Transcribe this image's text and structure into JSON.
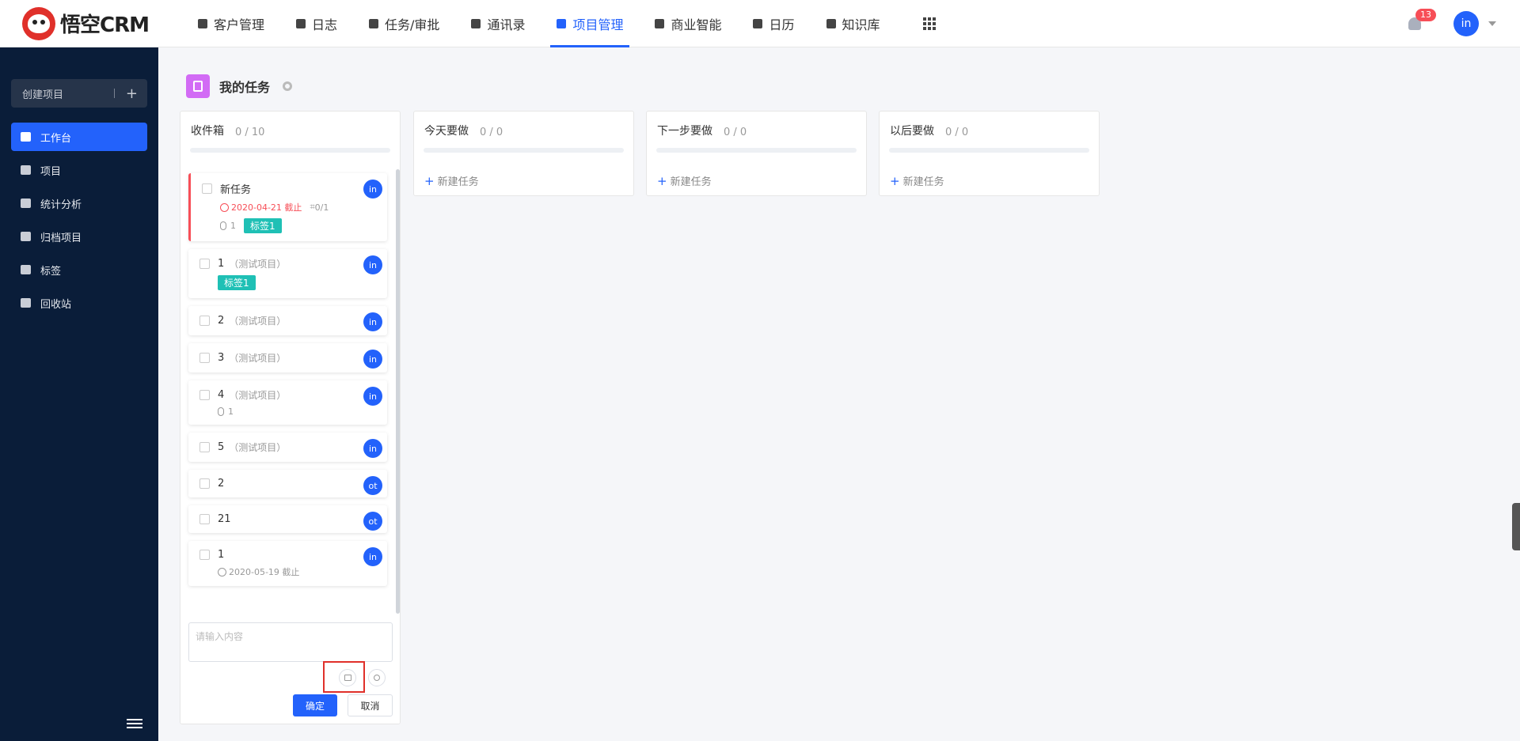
{
  "app": {
    "logo_text": "悟空CRM"
  },
  "nav": [
    {
      "label": "客户管理",
      "icon": "building-icon"
    },
    {
      "label": "日志",
      "icon": "journal-icon"
    },
    {
      "label": "任务/审批",
      "icon": "briefcase-icon"
    },
    {
      "label": "通讯录",
      "icon": "phone-book-icon"
    },
    {
      "label": "项目管理",
      "icon": "project-icon",
      "active": true
    },
    {
      "label": "商业智能",
      "icon": "bi-icon"
    },
    {
      "label": "日历",
      "icon": "calendar-icon"
    },
    {
      "label": "知识库",
      "icon": "book-icon"
    }
  ],
  "header": {
    "notification_count": "13",
    "user_initials": "in"
  },
  "sidebar": {
    "create_label": "创建项目",
    "create_plus": "+",
    "items": [
      {
        "label": "工作台",
        "active": true
      },
      {
        "label": "项目"
      },
      {
        "label": "统计分析"
      },
      {
        "label": "归档项目"
      },
      {
        "label": "标签"
      },
      {
        "label": "回收站"
      }
    ]
  },
  "page": {
    "title": "我的任务"
  },
  "columns": [
    {
      "title": "收件箱",
      "count": "0 / 10"
    },
    {
      "title": "今天要做",
      "count": "0 / 0",
      "new_task": "新建任务"
    },
    {
      "title": "下一步要做",
      "count": "0 / 0",
      "new_task": "新建任务"
    },
    {
      "title": "以后要做",
      "count": "0 / 0",
      "new_task": "新建任务"
    }
  ],
  "tasks": [
    {
      "name": "新任务",
      "project": "",
      "assignee": "in",
      "due": "2020-04-21 截止",
      "subtasks": "0/1",
      "attachments": "1",
      "tag": "标签1"
    },
    {
      "name": "1",
      "project": "（测试项目）",
      "assignee": "in",
      "tag": "标签1"
    },
    {
      "name": "2",
      "project": "（测试项目）",
      "assignee": "in"
    },
    {
      "name": "3",
      "project": "（测试项目）",
      "assignee": "in"
    },
    {
      "name": "4",
      "project": "（测试项目）",
      "assignee": "in",
      "attachments": "1"
    },
    {
      "name": "5",
      "project": "（测试项目）",
      "assignee": "in"
    },
    {
      "name": "2",
      "project": "",
      "assignee": "ot"
    },
    {
      "name": "21",
      "project": "",
      "assignee": "ot"
    },
    {
      "name": "1",
      "project": "",
      "assignee": "in",
      "due": "2020-05-19 截止"
    }
  ],
  "quick_add": {
    "placeholder": "请输入内容",
    "confirm": "确定",
    "cancel": "取消"
  },
  "colors": {
    "accent": "#2362fb",
    "sidebar": "#0a1d39",
    "tag": "#1fc0b5",
    "danger": "#f74e57"
  }
}
